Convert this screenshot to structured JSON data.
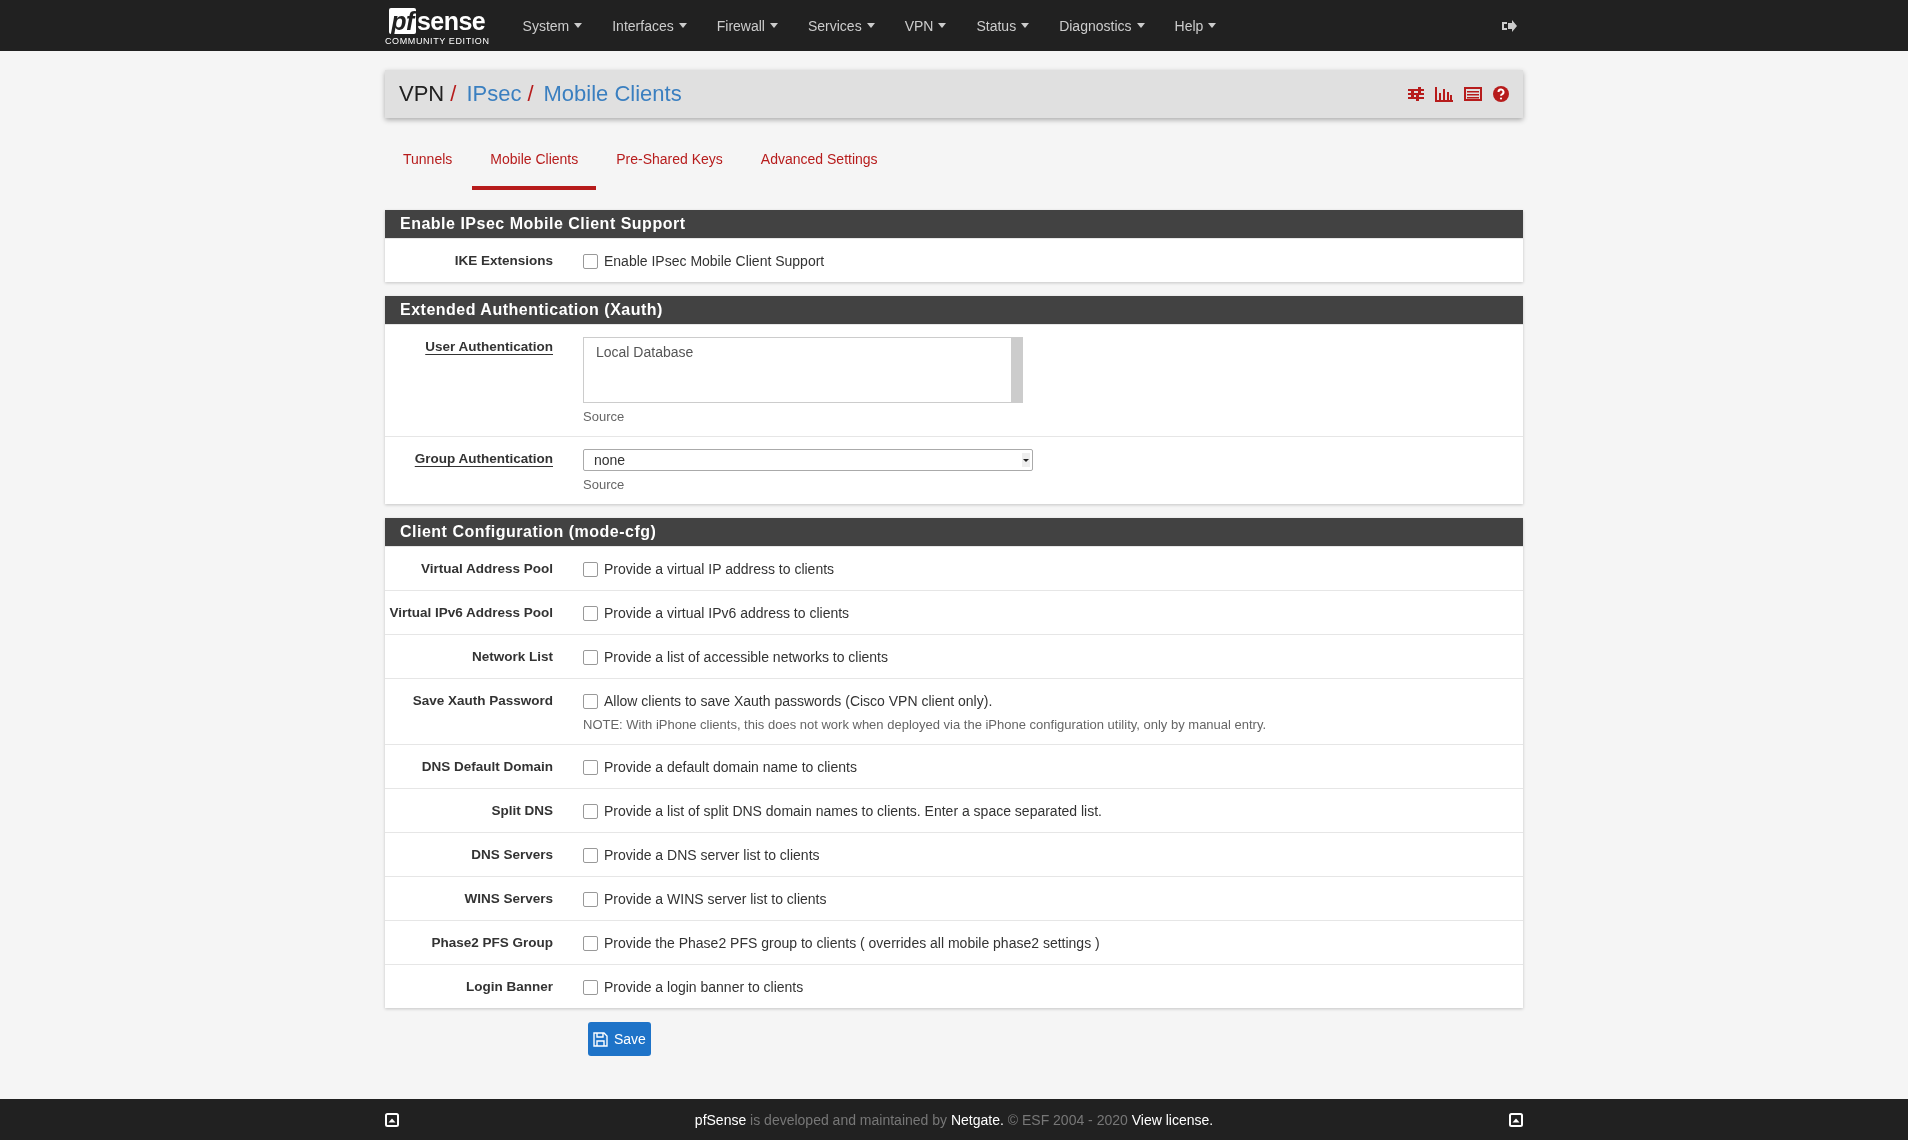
{
  "navbar": {
    "logo": {
      "mark": "pf",
      "word": "sense",
      "edition": "COMMUNITY EDITION"
    },
    "menu": [
      {
        "label": "System"
      },
      {
        "label": "Interfaces"
      },
      {
        "label": "Firewall"
      },
      {
        "label": "Services"
      },
      {
        "label": "VPN"
      },
      {
        "label": "Status"
      },
      {
        "label": "Diagnostics"
      },
      {
        "label": "Help"
      }
    ]
  },
  "breadcrumb": [
    {
      "label": "VPN",
      "link": false,
      "separator": "/"
    },
    {
      "label": "IPsec",
      "link": true,
      "separator": "/"
    },
    {
      "label": "Mobile Clients",
      "link": true
    }
  ],
  "tabs": [
    {
      "label": "Tunnels",
      "selected": false
    },
    {
      "label": "Mobile Clients",
      "selected": true
    },
    {
      "label": "Pre-Shared Keys",
      "selected": false
    },
    {
      "label": "Advanced Settings",
      "selected": false
    }
  ],
  "sections": [
    {
      "title": "Enable IPsec Mobile Client Support",
      "rows": [
        {
          "kind": "checkbox",
          "label": "IKE Extensions",
          "checked": false,
          "text": "Enable IPsec Mobile Client Support"
        }
      ]
    },
    {
      "title": "Extended Authentication (Xauth)",
      "rows": [
        {
          "kind": "listbox",
          "label": "User Authentication",
          "options": [
            "Local Database"
          ],
          "help": "Source"
        },
        {
          "kind": "select",
          "label": "Group Authentication",
          "value": "none",
          "help": "Source"
        }
      ]
    },
    {
      "title": "Client Configuration (mode-cfg)",
      "rows": [
        {
          "kind": "checkbox",
          "label": "Virtual Address Pool",
          "checked": false,
          "text": "Provide a virtual IP address to clients"
        },
        {
          "kind": "checkbox",
          "label": "Virtual IPv6 Address Pool",
          "checked": false,
          "text": "Provide a virtual IPv6 address to clients"
        },
        {
          "kind": "checkbox",
          "label": "Network List",
          "checked": false,
          "text": "Provide a list of accessible networks to clients"
        },
        {
          "kind": "checkbox",
          "label": "Save Xauth Password",
          "checked": false,
          "text": "Allow clients to save Xauth passwords (Cisco VPN client only).",
          "note": "NOTE: With iPhone clients, this does not work when deployed via the iPhone configuration utility, only by manual entry."
        },
        {
          "kind": "checkbox",
          "label": "DNS Default Domain",
          "checked": false,
          "text": "Provide a default domain name to clients"
        },
        {
          "kind": "checkbox",
          "label": "Split DNS",
          "checked": false,
          "text": "Provide a list of split DNS domain names to clients. Enter a space separated list."
        },
        {
          "kind": "checkbox",
          "label": "DNS Servers",
          "checked": false,
          "text": "Provide a DNS server list to clients"
        },
        {
          "kind": "checkbox",
          "label": "WINS Servers",
          "checked": false,
          "text": "Provide a WINS server list to clients"
        },
        {
          "kind": "checkbox",
          "label": "Phase2 PFS Group",
          "checked": false,
          "text": "Provide the Phase2 PFS group to clients ( overrides all mobile phase2 settings )"
        },
        {
          "kind": "checkbox",
          "label": "Login Banner",
          "checked": false,
          "text": "Provide a login banner to clients"
        }
      ]
    }
  ],
  "save_button": "Save",
  "footer": [
    {
      "kind": "link",
      "text": "pfSense"
    },
    {
      "kind": "text",
      "text": " is developed and maintained by "
    },
    {
      "kind": "link",
      "text": "Netgate."
    },
    {
      "kind": "text",
      "text": " © ESF 2004 - 2020 "
    },
    {
      "kind": "link",
      "text": "View license."
    }
  ]
}
